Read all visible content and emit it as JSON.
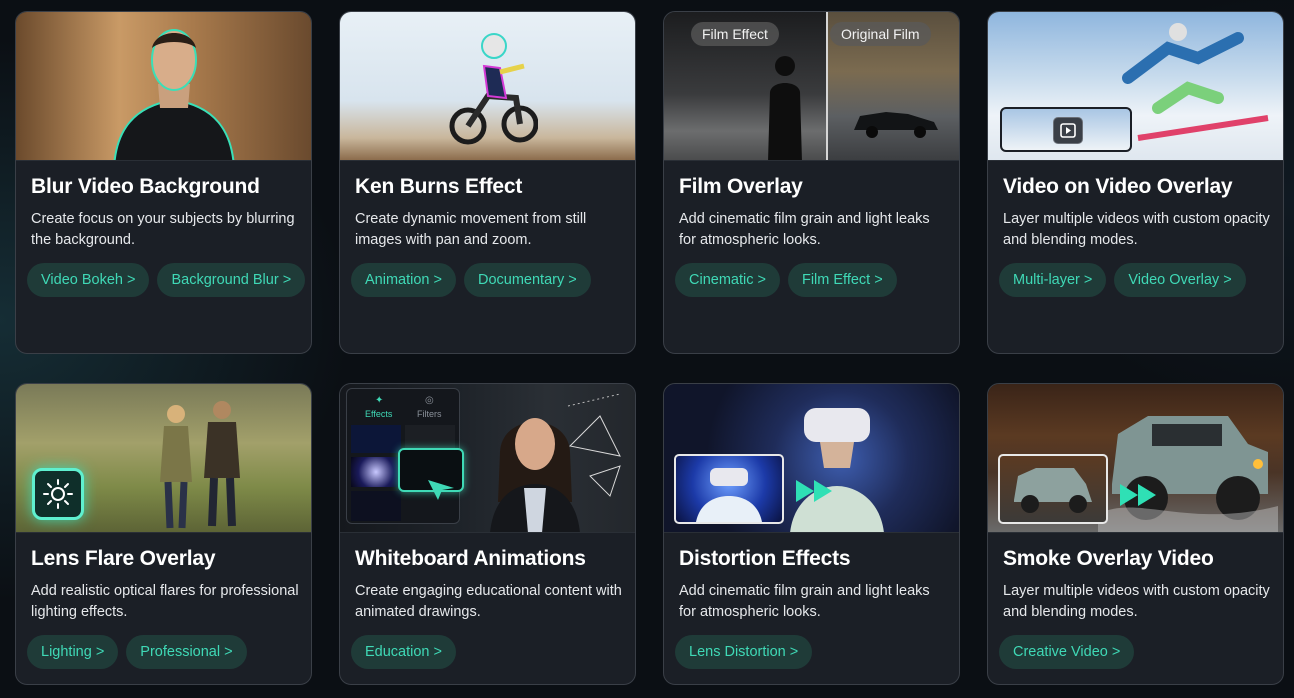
{
  "cards": [
    {
      "title": "Blur Video Background",
      "desc": "Create focus on your subjects by blurring the background.",
      "tags": [
        "Video Bokeh >",
        "Background Blur >"
      ]
    },
    {
      "title": "Ken Burns Effect",
      "desc": "Create dynamic movement from still images with pan and zoom.",
      "tags": [
        "Animation >",
        "Documentary >"
      ]
    },
    {
      "title": "Film Overlay",
      "desc": "Add cinematic film grain and light leaks for atmospheric looks.",
      "tags": [
        "Cinematic >",
        "Film Effect >"
      ],
      "thumb_labels": [
        "Film Effect",
        "Original Film"
      ]
    },
    {
      "title": "Video on Video Overlay",
      "desc": "Layer multiple videos with custom opacity and blending modes.",
      "tags": [
        "Multi-layer >",
        "Video Overlay >"
      ]
    },
    {
      "title": "Lens Flare Overlay",
      "desc": "Add realistic optical flares for professional lighting effects.",
      "tags": [
        "Lighting >",
        "Professional >"
      ]
    },
    {
      "title": "Whiteboard Animations",
      "desc": "Create engaging educational content with animated drawings.",
      "tags": [
        "Education >"
      ],
      "thumb_labels": [
        "Effects",
        "Filters"
      ]
    },
    {
      "title": "Distortion Effects",
      "desc": "Add cinematic film grain and light leaks for atmospheric looks.",
      "tags": [
        "Lens Distortion >"
      ]
    },
    {
      "title": "Smoke Overlay Video",
      "desc": "Layer multiple videos with custom opacity and blending modes.",
      "tags": [
        "Creative Video >"
      ]
    }
  ],
  "colors": {
    "card_bg": "#1b1f26",
    "tag_bg": "#1f3b38",
    "tag_text": "#3fd9b6",
    "accent": "#2fe0b5"
  },
  "icons": [
    "sun-icon",
    "play-icon",
    "arrow-right-icon",
    "effects-icon",
    "filters-icon"
  ]
}
